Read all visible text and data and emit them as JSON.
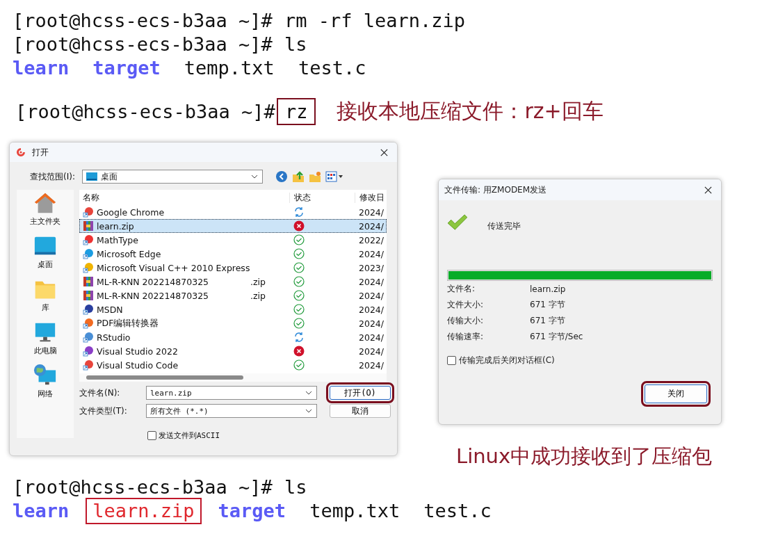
{
  "terminal_top": [
    {
      "prompt": "[root@hcss-ecs-b3aa ~]#",
      "command": "rm -rf learn.zip"
    },
    {
      "prompt": "[root@hcss-ecs-b3aa ~]#",
      "command": "ls"
    }
  ],
  "ls_output_1": [
    {
      "name": "learn",
      "kind": "dir",
      "highlighted": false
    },
    {
      "name": "target",
      "kind": "dir",
      "highlighted": false
    },
    {
      "name": "temp.txt",
      "kind": "file",
      "highlighted": false
    },
    {
      "name": "test.c",
      "kind": "file",
      "highlighted": false
    }
  ],
  "rz_line": {
    "prompt": "[root@hcss-ecs-b3aa ~]#",
    "command": "rz",
    "highlighted": true,
    "annotation": "接收本地压缩文件：rz+回车"
  },
  "open_dialog": {
    "title": "打开",
    "look_in_label": "查找范围(I):",
    "look_in_value": "桌面",
    "places": [
      {
        "label": "主文件夹",
        "kind": "home"
      },
      {
        "label": "桌面",
        "kind": "desktop"
      },
      {
        "label": "库",
        "kind": "library"
      },
      {
        "label": "此电脑",
        "kind": "computer"
      },
      {
        "label": "网络",
        "kind": "network"
      }
    ],
    "columns": [
      "名称",
      "状态",
      "修改日"
    ],
    "files": [
      {
        "name": "Google Chrome",
        "kind": "shortcut",
        "status": {
          "kind": "sync"
        },
        "date": "2024/",
        "selected": false
      },
      {
        "name": "learn.zip",
        "kind": "archive",
        "status": {
          "kind": "error"
        },
        "date": "2024/",
        "selected": true
      },
      {
        "name": "MathType",
        "kind": "shortcut",
        "status": {
          "kind": "ok"
        },
        "date": "2022/",
        "selected": false
      },
      {
        "name": "Microsoft Edge",
        "kind": "shortcut",
        "status": {
          "kind": "ok"
        },
        "date": "2024/",
        "selected": false
      },
      {
        "name": "Microsoft Visual C++ 2010 Express",
        "kind": "shortcut",
        "status": {
          "kind": "ok"
        },
        "date": "2023/",
        "selected": false
      },
      {
        "name": "ML-R-KNN 202214870325",
        "suffix": ".zip",
        "kind": "archive",
        "status": {
          "kind": "ok"
        },
        "date": "2024/",
        "selected": false
      },
      {
        "name": "ML-R-KNN 202214870325",
        "suffix": ".zip",
        "kind": "archive",
        "status": {
          "kind": "ok"
        },
        "date": "2024/",
        "selected": false
      },
      {
        "name": "MSDN",
        "kind": "shortcut",
        "status": {
          "kind": "ok"
        },
        "date": "2024/",
        "selected": false
      },
      {
        "name": "PDF编辑转换器",
        "kind": "shortcut",
        "status": {
          "kind": "ok"
        },
        "date": "2024/",
        "selected": false
      },
      {
        "name": "RStudio",
        "kind": "shortcut",
        "status": {
          "kind": "sync"
        },
        "date": "2024/",
        "selected": false
      },
      {
        "name": "Visual Studio 2022",
        "kind": "shortcut",
        "status": {
          "kind": "error"
        },
        "date": "2024/",
        "selected": false
      },
      {
        "name": "Visual Studio Code",
        "kind": "shortcut",
        "status": {
          "kind": "ok"
        },
        "date": "2024/",
        "selected": false
      }
    ],
    "filename_label": "文件名(N):",
    "filename_value": "learn.zip",
    "filetype_label": "文件类型(T):",
    "filetype_value": "所有文件 (*.*)",
    "open_button": {
      "label": "打开(O)",
      "highlighted": true
    },
    "cancel_button": "取消",
    "ascii_checkbox": {
      "label": "发送文件到ASCII",
      "checked": false
    }
  },
  "transfer_dialog": {
    "title": "文件传输: 用ZMODEM发送",
    "status": "传送完毕",
    "progress": {
      "level": 1
    },
    "fields": [
      {
        "label": "文件名:",
        "value": "learn.zip"
      },
      {
        "label": "文件大小:",
        "value": "671 字节"
      },
      {
        "label": "传输大小:",
        "value": "671 字节"
      },
      {
        "label": "传输速率:",
        "value": "671 字节/Sec"
      }
    ],
    "close_checkbox": {
      "label": "传输完成后关闭对话框(C)",
      "checked": false
    },
    "close_button": {
      "label": "关闭",
      "highlighted": true
    }
  },
  "result_annotation": "Linux中成功接收到了压缩包",
  "terminal_bottom": {
    "prompt": "[root@hcss-ecs-b3aa ~]#",
    "command": "ls"
  },
  "ls_output_2": [
    {
      "name": "learn",
      "kind": "dir",
      "highlighted": false
    },
    {
      "name": "learn.zip",
      "kind": "archive",
      "highlighted": true
    },
    {
      "name": "target",
      "kind": "dir",
      "highlighted": false
    },
    {
      "name": "temp.txt",
      "kind": "file",
      "highlighted": false
    },
    {
      "name": "test.c",
      "kind": "file",
      "highlighted": false
    }
  ]
}
